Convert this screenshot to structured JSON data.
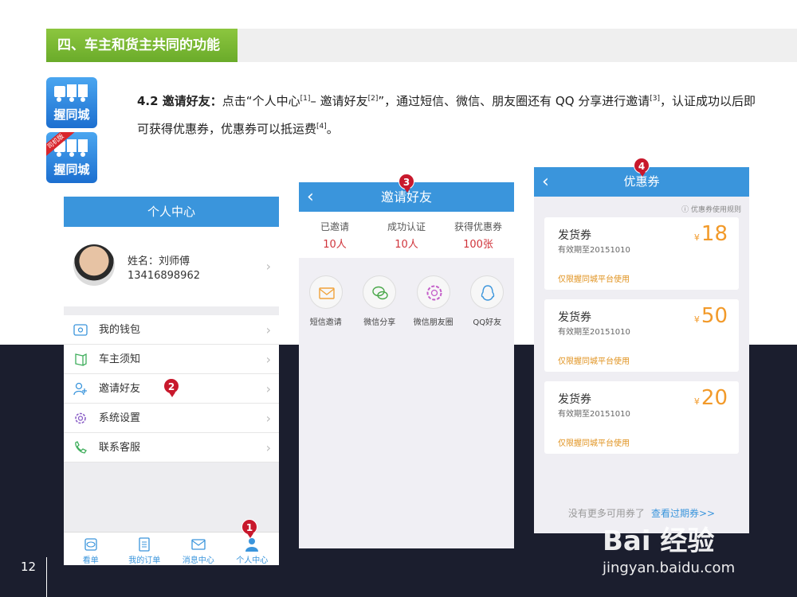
{
  "section_title": "四、车主和货主共同的功能",
  "logos": [
    {
      "name": "握同城"
    },
    {
      "name": "握同城",
      "ribbon": "司机版"
    }
  ],
  "paragraph": {
    "heading": "4.2  邀请好友：",
    "text_a": "点击“个人中心",
    "ref1": "[1]",
    "text_b": "– 邀请好友",
    "ref2": "[2]",
    "text_c": "”，通过短信、微信、朋友圈还有 QQ 分享进行邀请",
    "ref3": "[3]",
    "text_d": "，认证成功以后即可获得优惠券，优惠券可以抵运费",
    "ref4": "[4]",
    "text_e": "。"
  },
  "page_number": "12",
  "markers": [
    "1",
    "2",
    "3",
    "4"
  ],
  "phone1": {
    "title": "个人中心",
    "name_label": "姓名：刘师傅",
    "phone": "13416898962",
    "menu": [
      {
        "label": "我的钱包",
        "icon": "wallet-icon"
      },
      {
        "label": "车主须知",
        "icon": "notice-icon"
      },
      {
        "label": "邀请好友",
        "icon": "add-friend-icon"
      },
      {
        "label": "系统设置",
        "icon": "gear-icon"
      },
      {
        "label": "联系客服",
        "icon": "phone-icon"
      }
    ],
    "tabs": [
      {
        "label": "看单",
        "icon": "eye-icon"
      },
      {
        "label": "我的订单",
        "icon": "list-icon"
      },
      {
        "label": "消息中心",
        "icon": "mail-icon"
      },
      {
        "label": "个人中心",
        "icon": "person-icon"
      }
    ]
  },
  "phone2": {
    "title": "邀请好友",
    "stats": [
      {
        "label": "已邀请",
        "value": "10人"
      },
      {
        "label": "成功认证",
        "value": "10人"
      },
      {
        "label": "获得优惠券",
        "value": "100张"
      }
    ],
    "shares": [
      {
        "label": "短信邀请",
        "icon": "sms-icon"
      },
      {
        "label": "微信分享",
        "icon": "wechat-icon"
      },
      {
        "label": "微信朋友圈",
        "icon": "moments-icon"
      },
      {
        "label": "QQ好友",
        "icon": "qq-icon"
      }
    ]
  },
  "phone3": {
    "title": "优惠券",
    "rules_link": "优惠券使用规则",
    "coupons": [
      {
        "title": "发货券",
        "date": "有效期至20151010",
        "note": "仅限握同城平台使用",
        "currency": "¥",
        "amount": "18"
      },
      {
        "title": "发货券",
        "date": "有效期至20151010",
        "note": "仅限握同城平台使用",
        "currency": "¥",
        "amount": "50"
      },
      {
        "title": "发货券",
        "date": "有效期至20151010",
        "note": "仅限握同城平台使用",
        "currency": "¥",
        "amount": "20"
      }
    ],
    "footer_text": "没有更多可用券了",
    "footer_link": "查看过期券>>"
  },
  "watermark": {
    "line1": "Bai 经验",
    "line2": "jingyan.baidu.com"
  },
  "colors": {
    "accent": "#3a95dc",
    "header_green": "#7ab839",
    "marker_red": "#c8182c",
    "coupon_orange": "#f29a2a",
    "dark_bg": "#1b1e2e"
  }
}
